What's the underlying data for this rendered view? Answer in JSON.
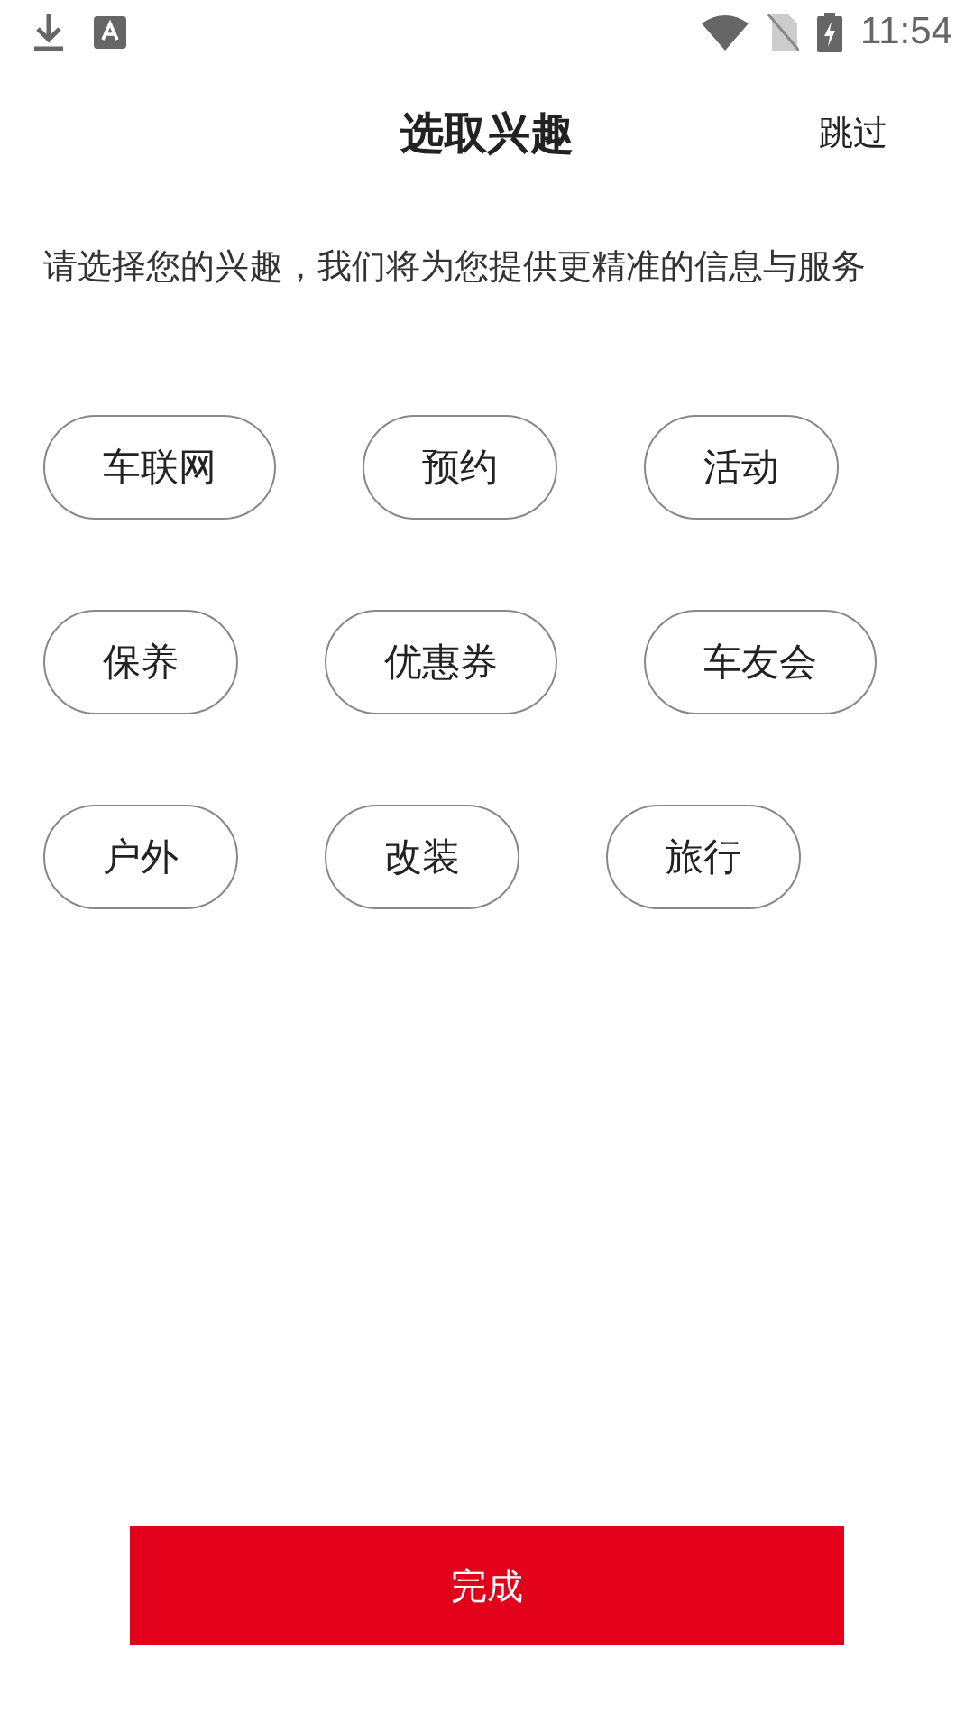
{
  "status_bar": {
    "time": "11:54"
  },
  "header": {
    "title": "选取兴趣",
    "skip": "跳过"
  },
  "description": "请选择您的兴趣，我们将为您提供更精准的信息与服务",
  "interest_rows": [
    [
      {
        "label": "车联网",
        "selected": false
      },
      {
        "label": "预约",
        "selected": false
      },
      {
        "label": "活动",
        "selected": false
      }
    ],
    [
      {
        "label": "保养",
        "selected": false
      },
      {
        "label": "优惠券",
        "selected": false
      },
      {
        "label": "车友会",
        "selected": false
      }
    ],
    [
      {
        "label": "户外",
        "selected": false
      },
      {
        "label": "改装",
        "selected": false
      },
      {
        "label": "旅行",
        "selected": false
      }
    ]
  ],
  "done_button": "完成"
}
